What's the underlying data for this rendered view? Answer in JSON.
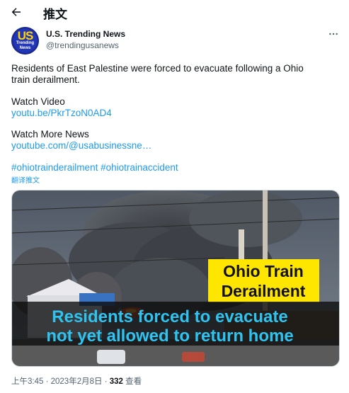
{
  "header": {
    "title": "推文"
  },
  "author": {
    "name": "U.S. Trending News",
    "handle": "@trendingusanews",
    "avatar_letters": "US",
    "avatar_sub": "Trending News"
  },
  "tweet": {
    "text_line1": "Residents of East Palestine were forced to evacuate following a Ohio",
    "text_line2": "train derailment.",
    "watch_video_label": "Watch Video",
    "video_link": "youtu.be/PkrTzoN0AD4",
    "watch_more_label": "Watch More News",
    "more_link": "youtube.com/@usabusinessne…",
    "hashtag1": "#ohiotrainderailment",
    "hashtag2": "#ohiotrainaccident",
    "translate_label": "翻译推文"
  },
  "media": {
    "banner_line1": "Ohio Train",
    "banner_line2": "Derailment",
    "caption_line1": "Residents forced to evacuate",
    "caption_line2": "not yet allowed to return home"
  },
  "meta": {
    "time": "上午3:45",
    "date": "2023年2月8日",
    "views_count": "332",
    "views_label": "查看"
  },
  "colors": {
    "link": "#1d9bf0",
    "banner": "#ffe600",
    "caption": "#2ec4f2"
  }
}
